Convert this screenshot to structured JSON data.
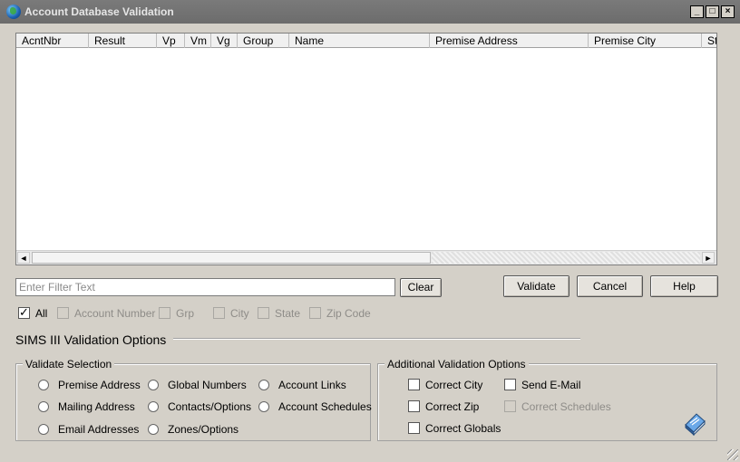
{
  "window": {
    "title": "Account Database Validation"
  },
  "controls": {
    "minimize": "_",
    "maximize": "□",
    "close": "×"
  },
  "grid": {
    "columns": [
      "AcntNbr",
      "Result",
      "Vp",
      "Vm",
      "Vg",
      "Group",
      "Name",
      "Premise Address",
      "Premise City",
      "St"
    ],
    "rows": []
  },
  "filter": {
    "placeholder": "Enter Filter Text",
    "value": ""
  },
  "buttons": {
    "clear": "Clear",
    "validate": "Validate",
    "cancel": "Cancel",
    "help": "Help"
  },
  "filter_options": [
    {
      "label": "All",
      "checked": true,
      "enabled": true
    },
    {
      "label": "Account Number",
      "checked": false,
      "enabled": false
    },
    {
      "label": "Grp",
      "checked": false,
      "enabled": false
    },
    {
      "label": "City",
      "checked": false,
      "enabled": false
    },
    {
      "label": "State",
      "checked": false,
      "enabled": false
    },
    {
      "label": "Zip Code",
      "checked": false,
      "enabled": false
    }
  ],
  "sims": {
    "title": "SIMS III Validation Options",
    "validate_selection": {
      "legend": "Validate Selection",
      "options": [
        "Premise Address",
        "Global Numbers",
        "Account Links",
        "Mailing Address",
        "Contacts/Options",
        "Account Schedules",
        "Email Addresses",
        "Zones/Options"
      ]
    },
    "additional": {
      "legend": "Additional Validation Options",
      "options": [
        {
          "label": "Correct City",
          "enabled": true
        },
        {
          "label": "Send E-Mail",
          "enabled": true
        },
        {
          "label": "Correct Zip",
          "enabled": true
        },
        {
          "label": "Correct Schedules",
          "enabled": false
        },
        {
          "label": "Correct Globals",
          "enabled": true
        }
      ]
    }
  },
  "icons": {
    "app": "globe-icon",
    "help_book": "book-icon",
    "resize": "resize-grip-icon"
  }
}
